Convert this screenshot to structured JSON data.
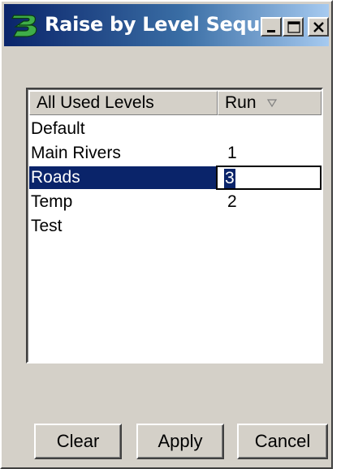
{
  "window": {
    "title": "Raise by Level Sequ...",
    "controls": [
      "minimize-icon",
      "maximize-icon",
      "close-icon"
    ],
    "app_icon": "bentley-b-icon"
  },
  "list": {
    "columns": {
      "levels": "All Used Levels",
      "run": "Run"
    },
    "sort_icon": "sort-triangle-icon",
    "rows": [
      {
        "name": "Default",
        "run": ""
      },
      {
        "name": "Main Rivers",
        "run": "1"
      },
      {
        "name": "Roads",
        "run": "3",
        "selected": true,
        "editing": true
      },
      {
        "name": "Temp",
        "run": "2"
      },
      {
        "name": "Test",
        "run": ""
      }
    ]
  },
  "buttons": {
    "clear": "Clear",
    "apply": "Apply",
    "cancel": "Cancel"
  },
  "colors": {
    "selection": "#0a246a",
    "titlebar_start": "#0a246a",
    "titlebar_end": "#a6caf0",
    "face": "#d4d0c8",
    "app_icon_green": "#3fae49"
  }
}
